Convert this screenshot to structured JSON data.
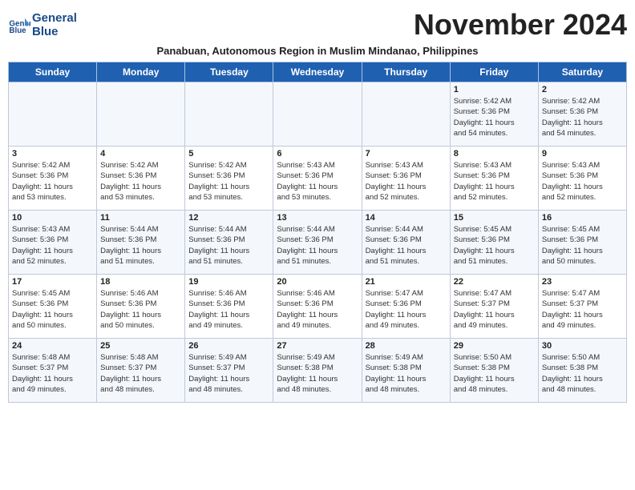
{
  "header": {
    "logo_line1": "General",
    "logo_line2": "Blue",
    "month_title": "November 2024",
    "subtitle": "Panabuan, Autonomous Region in Muslim Mindanao, Philippines"
  },
  "weekdays": [
    "Sunday",
    "Monday",
    "Tuesday",
    "Wednesday",
    "Thursday",
    "Friday",
    "Saturday"
  ],
  "weeks": [
    [
      {
        "day": "",
        "info": ""
      },
      {
        "day": "",
        "info": ""
      },
      {
        "day": "",
        "info": ""
      },
      {
        "day": "",
        "info": ""
      },
      {
        "day": "",
        "info": ""
      },
      {
        "day": "1",
        "info": "Sunrise: 5:42 AM\nSunset: 5:36 PM\nDaylight: 11 hours\nand 54 minutes."
      },
      {
        "day": "2",
        "info": "Sunrise: 5:42 AM\nSunset: 5:36 PM\nDaylight: 11 hours\nand 54 minutes."
      }
    ],
    [
      {
        "day": "3",
        "info": "Sunrise: 5:42 AM\nSunset: 5:36 PM\nDaylight: 11 hours\nand 53 minutes."
      },
      {
        "day": "4",
        "info": "Sunrise: 5:42 AM\nSunset: 5:36 PM\nDaylight: 11 hours\nand 53 minutes."
      },
      {
        "day": "5",
        "info": "Sunrise: 5:42 AM\nSunset: 5:36 PM\nDaylight: 11 hours\nand 53 minutes."
      },
      {
        "day": "6",
        "info": "Sunrise: 5:43 AM\nSunset: 5:36 PM\nDaylight: 11 hours\nand 53 minutes."
      },
      {
        "day": "7",
        "info": "Sunrise: 5:43 AM\nSunset: 5:36 PM\nDaylight: 11 hours\nand 52 minutes."
      },
      {
        "day": "8",
        "info": "Sunrise: 5:43 AM\nSunset: 5:36 PM\nDaylight: 11 hours\nand 52 minutes."
      },
      {
        "day": "9",
        "info": "Sunrise: 5:43 AM\nSunset: 5:36 PM\nDaylight: 11 hours\nand 52 minutes."
      }
    ],
    [
      {
        "day": "10",
        "info": "Sunrise: 5:43 AM\nSunset: 5:36 PM\nDaylight: 11 hours\nand 52 minutes."
      },
      {
        "day": "11",
        "info": "Sunrise: 5:44 AM\nSunset: 5:36 PM\nDaylight: 11 hours\nand 51 minutes."
      },
      {
        "day": "12",
        "info": "Sunrise: 5:44 AM\nSunset: 5:36 PM\nDaylight: 11 hours\nand 51 minutes."
      },
      {
        "day": "13",
        "info": "Sunrise: 5:44 AM\nSunset: 5:36 PM\nDaylight: 11 hours\nand 51 minutes."
      },
      {
        "day": "14",
        "info": "Sunrise: 5:44 AM\nSunset: 5:36 PM\nDaylight: 11 hours\nand 51 minutes."
      },
      {
        "day": "15",
        "info": "Sunrise: 5:45 AM\nSunset: 5:36 PM\nDaylight: 11 hours\nand 51 minutes."
      },
      {
        "day": "16",
        "info": "Sunrise: 5:45 AM\nSunset: 5:36 PM\nDaylight: 11 hours\nand 50 minutes."
      }
    ],
    [
      {
        "day": "17",
        "info": "Sunrise: 5:45 AM\nSunset: 5:36 PM\nDaylight: 11 hours\nand 50 minutes."
      },
      {
        "day": "18",
        "info": "Sunrise: 5:46 AM\nSunset: 5:36 PM\nDaylight: 11 hours\nand 50 minutes."
      },
      {
        "day": "19",
        "info": "Sunrise: 5:46 AM\nSunset: 5:36 PM\nDaylight: 11 hours\nand 49 minutes."
      },
      {
        "day": "20",
        "info": "Sunrise: 5:46 AM\nSunset: 5:36 PM\nDaylight: 11 hours\nand 49 minutes."
      },
      {
        "day": "21",
        "info": "Sunrise: 5:47 AM\nSunset: 5:36 PM\nDaylight: 11 hours\nand 49 minutes."
      },
      {
        "day": "22",
        "info": "Sunrise: 5:47 AM\nSunset: 5:37 PM\nDaylight: 11 hours\nand 49 minutes."
      },
      {
        "day": "23",
        "info": "Sunrise: 5:47 AM\nSunset: 5:37 PM\nDaylight: 11 hours\nand 49 minutes."
      }
    ],
    [
      {
        "day": "24",
        "info": "Sunrise: 5:48 AM\nSunset: 5:37 PM\nDaylight: 11 hours\nand 49 minutes."
      },
      {
        "day": "25",
        "info": "Sunrise: 5:48 AM\nSunset: 5:37 PM\nDaylight: 11 hours\nand 48 minutes."
      },
      {
        "day": "26",
        "info": "Sunrise: 5:49 AM\nSunset: 5:37 PM\nDaylight: 11 hours\nand 48 minutes."
      },
      {
        "day": "27",
        "info": "Sunrise: 5:49 AM\nSunset: 5:38 PM\nDaylight: 11 hours\nand 48 minutes."
      },
      {
        "day": "28",
        "info": "Sunrise: 5:49 AM\nSunset: 5:38 PM\nDaylight: 11 hours\nand 48 minutes."
      },
      {
        "day": "29",
        "info": "Sunrise: 5:50 AM\nSunset: 5:38 PM\nDaylight: 11 hours\nand 48 minutes."
      },
      {
        "day": "30",
        "info": "Sunrise: 5:50 AM\nSunset: 5:38 PM\nDaylight: 11 hours\nand 48 minutes."
      }
    ]
  ]
}
